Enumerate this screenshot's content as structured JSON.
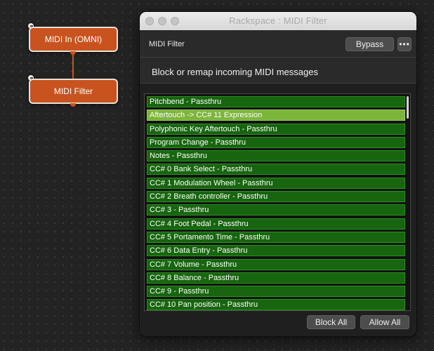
{
  "graph": {
    "nodes": [
      {
        "label": "MIDI In (OMNI)"
      },
      {
        "label": "MIDI Filter"
      }
    ]
  },
  "window": {
    "title": "Rackspace : MIDI Filter",
    "plugin_name": "MIDI Filter",
    "bypass_label": "Bypass",
    "more_label": "•••",
    "description": "Block or remap incoming MIDI messages",
    "items": [
      {
        "label": "Pitchbend - Passthru",
        "selected": false
      },
      {
        "label": "Aftertouch -> CC# 11 Expression",
        "selected": true
      },
      {
        "label": "Polyphonic Key Aftertouch - Passthru",
        "selected": false
      },
      {
        "label": "Program Change - Passthru",
        "selected": false
      },
      {
        "label": "Notes - Passthru",
        "selected": false
      },
      {
        "label": "CC# 0 Bank Select - Passthru",
        "selected": false
      },
      {
        "label": "CC# 1 Modulation Wheel - Passthru",
        "selected": false
      },
      {
        "label": "CC# 2 Breath controller - Passthru",
        "selected": false
      },
      {
        "label": "CC# 3 - Passthru",
        "selected": false
      },
      {
        "label": "CC# 4 Foot Pedal - Passthru",
        "selected": false
      },
      {
        "label": "CC# 5 Portamento Time - Passthru",
        "selected": false
      },
      {
        "label": "CC# 6 Data Entry - Passthru",
        "selected": false
      },
      {
        "label": "CC# 7 Volume - Passthru",
        "selected": false
      },
      {
        "label": "CC# 8 Balance - Passthru",
        "selected": false
      },
      {
        "label": "CC# 9 - Passthru",
        "selected": false
      },
      {
        "label": "CC# 10 Pan position - Passthru",
        "selected": false
      }
    ],
    "block_all_label": "Block All",
    "allow_all_label": "Allow All"
  },
  "colors": {
    "node_fill": "#c8531f",
    "row_fill": "#17650e",
    "row_selected": "#7cb53c"
  }
}
